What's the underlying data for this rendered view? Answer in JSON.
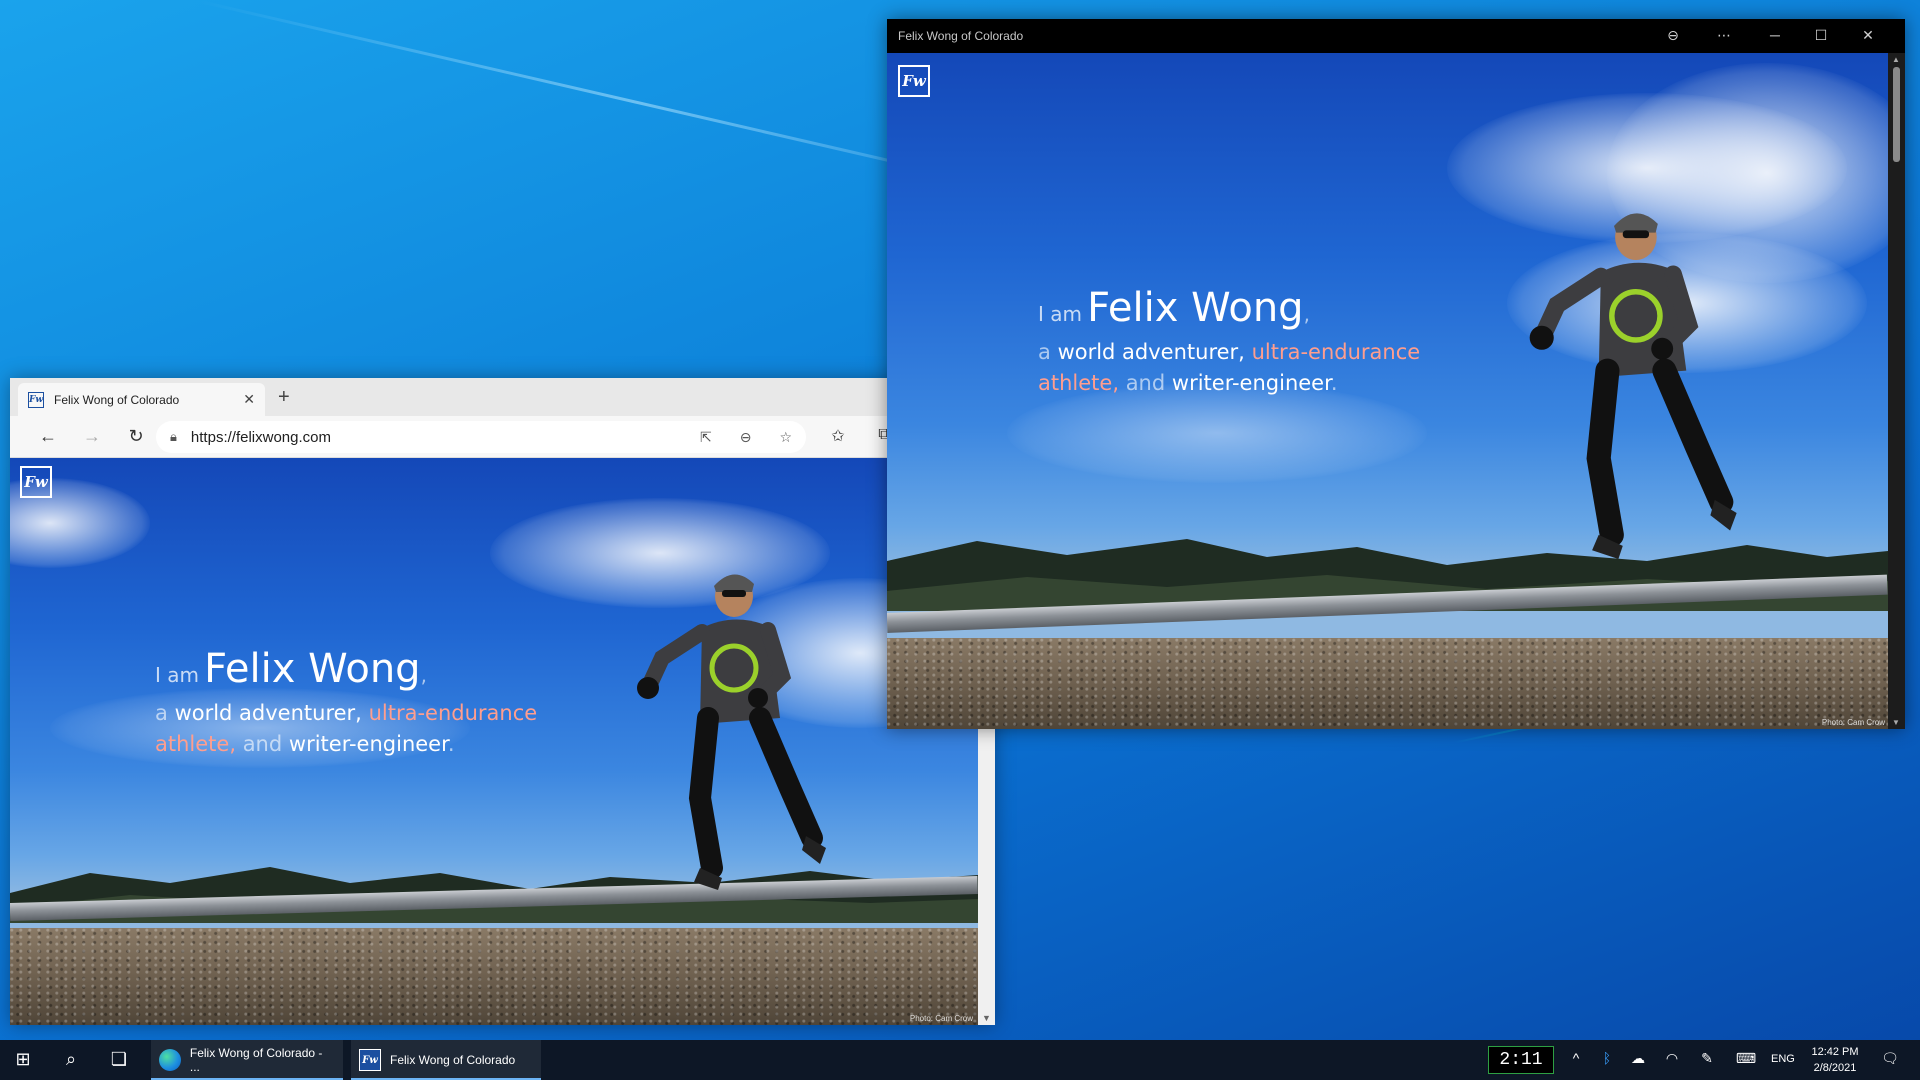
{
  "desktop": {},
  "browser": {
    "tab_title": "Felix Wong of Colorado",
    "tab_close": "✕",
    "new_tab": "+",
    "url": "https://felixwong.com",
    "icons": [
      "back-icon",
      "forward-icon",
      "refresh-icon",
      "lock-icon",
      "open-in-app-icon",
      "zoom-out-icon",
      "add-favorite-icon",
      "favorites-icon",
      "collections-icon"
    ]
  },
  "app_window": {
    "title": "Felix Wong of Colorado",
    "controls": [
      "zoom-icon",
      "more-icon",
      "minimize-icon",
      "maximize-icon",
      "close-icon"
    ]
  },
  "hero": {
    "logo": "Fw",
    "line1": {
      "i_am": "I am",
      "name": "Felix Wong",
      "comma": ","
    },
    "line2": {
      "a": "a",
      "world_adventurer": "world adventurer,",
      "ultra": "ultra-endurance",
      "athlete": "athlete,",
      "and": "and",
      "writer": "writer-engineer",
      "period": "."
    },
    "credit": "Photo: Cam Crow"
  },
  "taskbar": {
    "app1_label": "Felix Wong of Colorado - ...",
    "app2_label": "Felix Wong of Colorado",
    "timer": "2:11",
    "lang": "ENG",
    "time": "12:42 PM",
    "date": "2/8/2021"
  },
  "colors": {
    "accent_pink": "#ff9e8e",
    "taskbar": "#0d1726",
    "timer_border": "#2ea043"
  }
}
